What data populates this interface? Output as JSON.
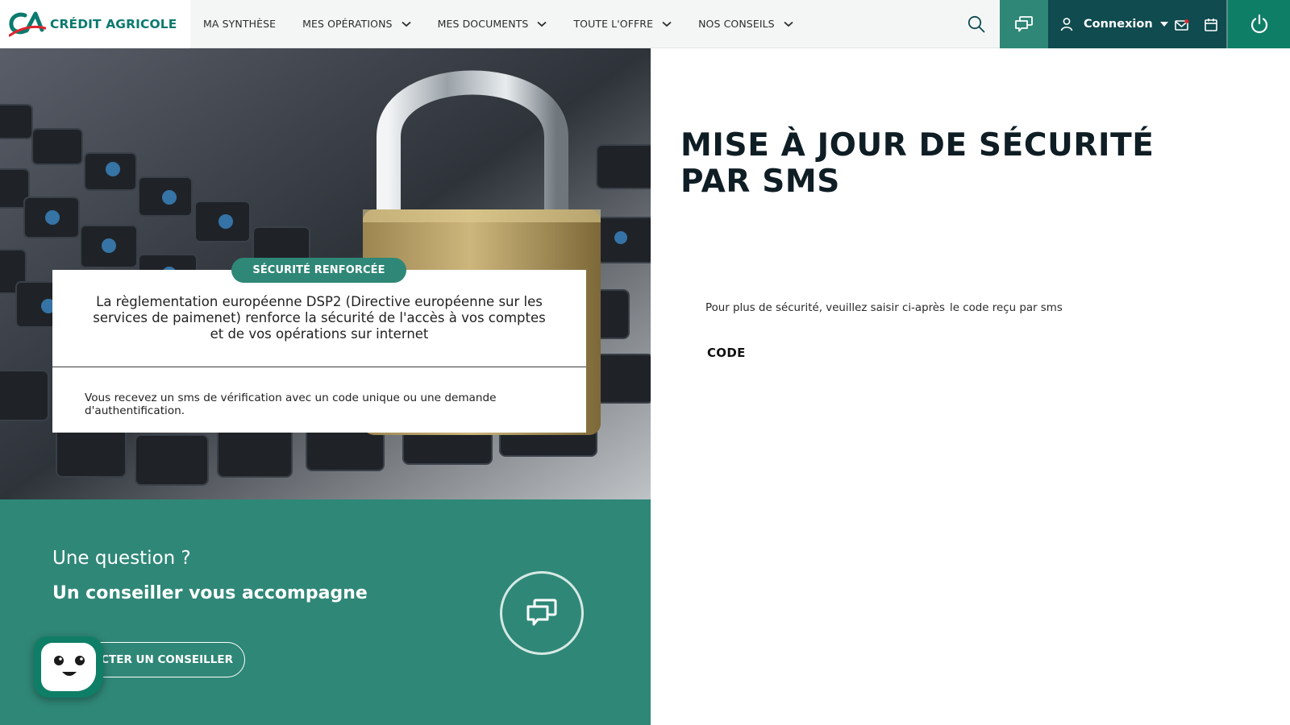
{
  "header": {
    "brand": "CRÉDIT AGRICOLE",
    "nav": [
      {
        "label": "MA SYNTHÈSE",
        "dropdown": false
      },
      {
        "label": "MES OPÉRATIONS",
        "dropdown": true
      },
      {
        "label": "MES DOCUMENTS",
        "dropdown": true
      },
      {
        "label": "TOUTE L'OFFRE",
        "dropdown": true
      },
      {
        "label": "NOS CONSEILS",
        "dropdown": true
      }
    ],
    "account_label": "Connexion",
    "icons": [
      "search-icon",
      "chat-icon",
      "user-icon",
      "caret-down-icon",
      "mail-icon",
      "calendar-icon",
      "power-icon"
    ]
  },
  "hero": {
    "badge": "SÉCURITÉ RENFORCÉE",
    "main_text": "La règlementation européenne DSP2 (Directive européenne sur les services de paimenet) renforce la sécurité de l'accès à vos comptes et de vos opérations sur internet",
    "sub_text": "Vous recevez un sms de vérification avec un code unique ou une demande d'authentification."
  },
  "question": {
    "title": "Une question ?",
    "subtitle": "Un conseiller vous accompagne",
    "button_label": "ACTER UN CONSEILLER"
  },
  "content": {
    "title": "MISE À JOUR DE SÉCURITÉ PAR SMS",
    "instruction_part1": "Pour plus de sécurité, veuillez saisir ci-après",
    "instruction_part2": "le code reçu par sms",
    "code_label": "CODE"
  },
  "colors": {
    "brand_green": "#0b7a6f",
    "teal": "#2f8777",
    "dark_teal": "#0f4b4f",
    "power_green": "#0f7e67",
    "title_navy": "#0f1d24",
    "notification_red": "#e0242f"
  }
}
